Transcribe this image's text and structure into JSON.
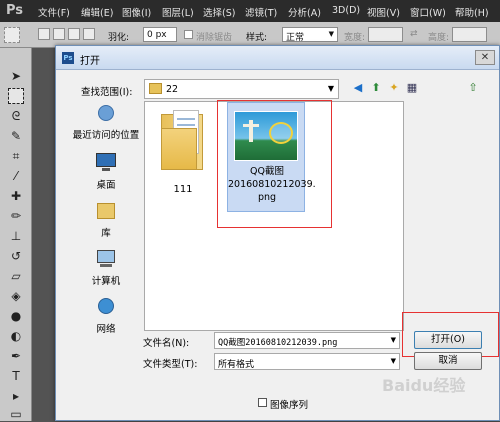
{
  "menubar": {
    "logo": "Ps",
    "items": [
      "文件(F)",
      "编辑(E)",
      "图像(I)",
      "图层(L)",
      "选择(S)",
      "滤镜(T)",
      "分析(A)",
      "3D(D)",
      "视图(V)",
      "窗口(W)",
      "帮助(H)"
    ]
  },
  "options": {
    "feather_label": "羽化:",
    "feather_value": "0 px",
    "antialias_label": "消除锯齿",
    "style_label": "样式:",
    "style_value": "正常",
    "width_label": "宽度:",
    "height_label": "高度:"
  },
  "dialog": {
    "title": "打开",
    "title_icon": "Ps",
    "lookin_label": "查找范围(I):",
    "lookin_value": "22",
    "places": [
      "最近访问的位置",
      "桌面",
      "库",
      "计算机",
      "网络"
    ],
    "files": [
      {
        "name": "111",
        "type": "folder"
      },
      {
        "name": "QQ截图20160810212039.png",
        "type": "image",
        "selected": true,
        "label_lines": [
          "QQ截图",
          "20160810212039.",
          "png"
        ]
      }
    ],
    "filename_label": "文件名(N):",
    "filename_value": "QQ截图20160810212039.png",
    "filetype_label": "文件类型(T):",
    "filetype_value": "所有格式",
    "open_button": "打开(O)",
    "cancel_button": "取消",
    "image_sequence_label": "图像序列"
  },
  "watermark": "Baidu经验",
  "colors": {
    "highlight": "#e63232",
    "selection": "#c9daf3"
  }
}
